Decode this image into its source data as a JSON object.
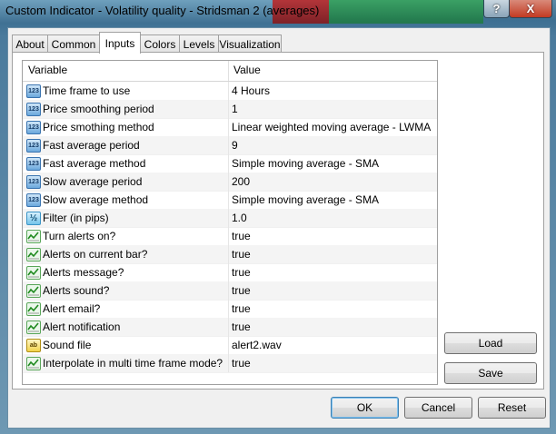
{
  "window": {
    "title": "Custom Indicator - Volatility quality - Stridsman 2 (averages)"
  },
  "titlebar": {
    "help_label": "?",
    "close_label": "X"
  },
  "tabs": [
    {
      "label": "About"
    },
    {
      "label": "Common"
    },
    {
      "label": "Inputs"
    },
    {
      "label": "Colors"
    },
    {
      "label": "Levels"
    },
    {
      "label": "Visualization"
    }
  ],
  "active_tab": "Inputs",
  "grid": {
    "headers": {
      "variable": "Variable",
      "value": "Value"
    },
    "rows": [
      {
        "icon": "123",
        "name": "Time frame to use",
        "value": "4 Hours"
      },
      {
        "icon": "123",
        "name": "Price smoothing period",
        "value": "1"
      },
      {
        "icon": "123",
        "name": "Price smothing method",
        "value": "Linear weighted moving average - LWMA"
      },
      {
        "icon": "123",
        "name": "Fast average period",
        "value": "9"
      },
      {
        "icon": "123",
        "name": "Fast average method",
        "value": "Simple moving average - SMA"
      },
      {
        "icon": "123",
        "name": "Slow average period",
        "value": "200"
      },
      {
        "icon": "123",
        "name": "Slow average method",
        "value": "Simple moving average - SMA"
      },
      {
        "icon": "v2",
        "name": "Filter (in pips)",
        "value": "1.0"
      },
      {
        "icon": "bool",
        "name": "Turn alerts on?",
        "value": "true"
      },
      {
        "icon": "bool",
        "name": "Alerts on current bar?",
        "value": "true"
      },
      {
        "icon": "bool",
        "name": "Alerts message?",
        "value": "true"
      },
      {
        "icon": "bool",
        "name": "Alerts sound?",
        "value": "true"
      },
      {
        "icon": "bool",
        "name": "Alert email?",
        "value": "true"
      },
      {
        "icon": "bool",
        "name": "Alert notification",
        "value": "true"
      },
      {
        "icon": "ab",
        "name": "Sound file",
        "value": "alert2.wav"
      },
      {
        "icon": "bool",
        "name": "Interpolate in multi time frame mode?",
        "value": "true"
      }
    ]
  },
  "side_buttons": {
    "load": "Load",
    "save": "Save"
  },
  "footer": {
    "ok": "OK",
    "cancel": "Cancel",
    "reset": "Reset"
  },
  "icon_names": {
    "123": "integer-type-icon",
    "v2": "double-type-icon",
    "bool": "bool-type-icon",
    "ab": "string-type-icon"
  }
}
